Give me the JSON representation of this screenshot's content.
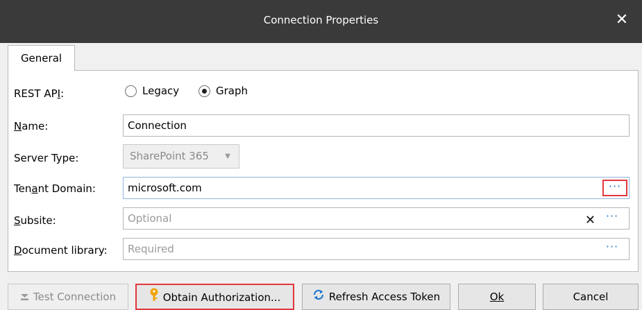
{
  "window": {
    "title": "Connection Properties",
    "close_glyph": "✕"
  },
  "tabs": [
    {
      "label": "General"
    }
  ],
  "form": {
    "rest_api": {
      "label": "REST API:",
      "options": [
        {
          "label": "Legacy",
          "selected": false
        },
        {
          "label": "Graph",
          "selected": true
        }
      ]
    },
    "name": {
      "label": "Name:",
      "value": "Connection"
    },
    "server_type": {
      "label": "Server Type:",
      "value": "SharePoint 365",
      "enabled": false
    },
    "tenant_domain": {
      "label": "Tenant Domain:",
      "value": "microsoft.com",
      "browse": "···"
    },
    "subsite": {
      "label": "Subsite:",
      "value": "",
      "placeholder": "Optional",
      "browse": "···",
      "clear": "✕"
    },
    "document_library": {
      "label": "Document library:",
      "value": "",
      "placeholder": "Required",
      "browse": "···"
    }
  },
  "buttons": {
    "test_connection": {
      "label": "Test Connection",
      "enabled": false
    },
    "obtain_authorization": {
      "label": "Obtain Authorization..."
    },
    "refresh_token": {
      "label": "Refresh Access Token"
    },
    "ok": {
      "label": "Ok"
    },
    "cancel": {
      "label": "Cancel"
    }
  },
  "colors": {
    "highlight": "#e2363e",
    "accent": "#1f78d1",
    "key_icon": "#f0a30a"
  }
}
